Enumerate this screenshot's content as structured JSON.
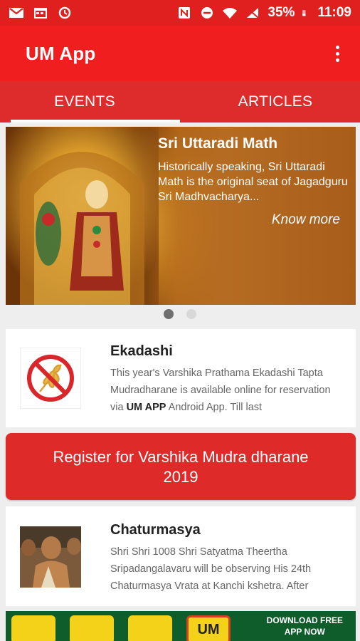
{
  "status_bar": {
    "battery": "35%",
    "time": "11:09",
    "icons": [
      "gmail-icon",
      "calendar-icon",
      "sync-icon",
      "nfc-icon",
      "dnd-icon",
      "wifi-icon",
      "no-signal-icon",
      "battery-icon"
    ]
  },
  "app_bar": {
    "title": "UM App",
    "menu_icon": "more-vert-icon"
  },
  "tabs": [
    {
      "label": "EVENTS",
      "active": true
    },
    {
      "label": "ARTICLES",
      "active": false
    }
  ],
  "banner": {
    "title": "Sri Uttaradi Math",
    "description": "Historically speaking, Sri Uttaradi Math is the original seat of Jagadguru Sri Madhvacharya...",
    "link": "Know more",
    "page_count": 2,
    "current_page": 1
  },
  "events": [
    {
      "title": "Ekadashi",
      "text_before": "This year's Varshika Prathama Ekadashi Tapta Mudradharane is available online for reservation via ",
      "text_bold": "UM APP",
      "text_after": " Android App. Till last",
      "thumb_icon": "no-grain-icon"
    },
    {
      "title": "Chaturmasya",
      "text": "Shri Shri 1008 Shri Satyatma Theertha Sripadangalavaru will be observing His 24th Chaturmasya Vrata at Kanchi kshetra. After",
      "thumb_icon": "swamiji-photo"
    }
  ],
  "register_button": {
    "line1": "Register for Varshika Mudra dharane",
    "line2": "2019"
  },
  "ad": {
    "um_label": "UM",
    "cta_line1": "DOWNLOAD FREE",
    "cta_line2": "APP NOW"
  },
  "colors": {
    "primary": "#f01e1e",
    "tab_bar": "#de2b2b",
    "register": "#df2a2a"
  }
}
